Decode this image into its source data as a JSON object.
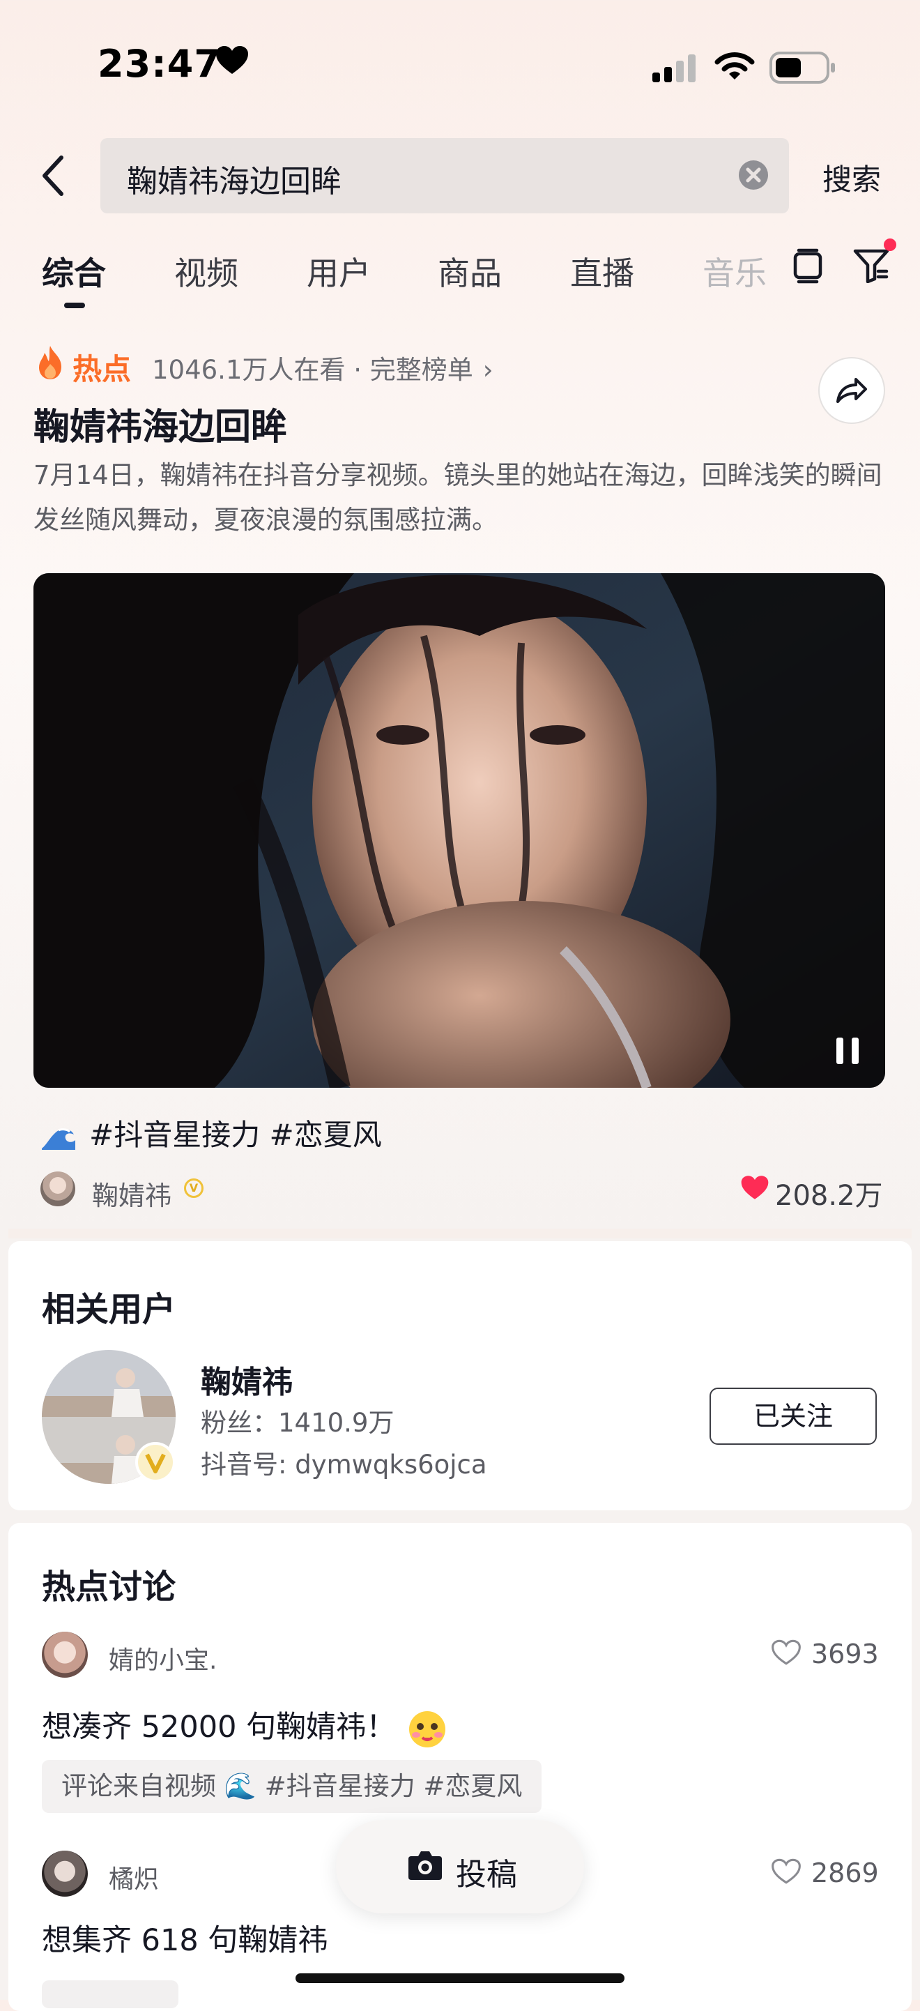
{
  "status_bar": {
    "time": "23:47"
  },
  "search": {
    "query": "鞠婧祎海边回眸",
    "button": "搜索"
  },
  "tabs": [
    {
      "label": "综合",
      "active": true
    },
    {
      "label": "视频"
    },
    {
      "label": "用户"
    },
    {
      "label": "商品"
    },
    {
      "label": "直播"
    },
    {
      "label": "音乐"
    }
  ],
  "hot": {
    "label": "热点",
    "viewers": "1046.1万人在看 · 完整榜单",
    "title": "鞠婧祎海边回眸",
    "description": "7月14日，鞠婧祎在抖音分享视频。镜头里的她站在海边，回眸浅笑的瞬间发丝随风舞动，夏夜浪漫的氛围感拉满。"
  },
  "video": {
    "caption": "#抖音星接力 #恋夏风",
    "author": "鞠婧祎",
    "likes": "208.2万"
  },
  "related_users": {
    "title": "相关用户",
    "user": {
      "name": "鞠婧祎",
      "fans": "粉丝：1410.9万",
      "id": "抖音号: dymwqks6ojca",
      "follow_label": "已关注"
    }
  },
  "discussion": {
    "title": "热点讨论",
    "comments": [
      {
        "user": "婧的小宝.",
        "likes": "3693",
        "text": "想凑齐 52000 句鞠婧祎！",
        "source": "评论来自视频 🌊 #抖音星接力 #恋夏风"
      },
      {
        "user": "橘炽",
        "likes": "2869",
        "text": "想集齐 618 句鞠婧祎"
      }
    ]
  },
  "post_button": {
    "label": "投稿"
  },
  "colors": {
    "accent": "#fe2c55",
    "hot": "#fb6d28",
    "verified": "#f0c23a"
  }
}
